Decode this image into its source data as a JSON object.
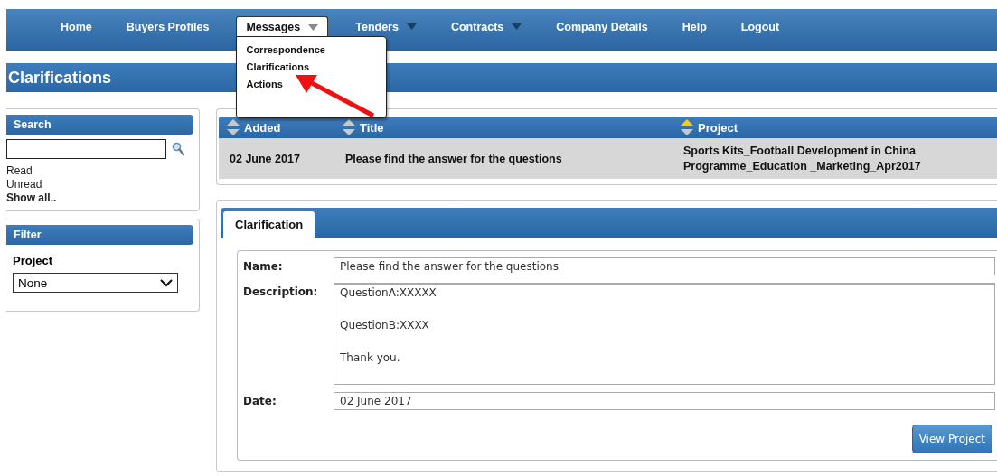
{
  "nav": {
    "items": [
      {
        "label": "Home",
        "selected": false,
        "has_menu": false
      },
      {
        "label": "Buyers Profiles",
        "selected": false,
        "has_menu": false
      },
      {
        "label": "Messages",
        "selected": true,
        "has_menu": true
      },
      {
        "label": "Tenders",
        "selected": false,
        "has_menu": true
      },
      {
        "label": "Contracts",
        "selected": false,
        "has_menu": true
      },
      {
        "label": "Company Details",
        "selected": false,
        "has_menu": false
      },
      {
        "label": "Help",
        "selected": false,
        "has_menu": false
      },
      {
        "label": "Logout",
        "selected": false,
        "has_menu": false
      }
    ],
    "open_menu": {
      "items": [
        "Correspondence",
        "Clarifications",
        "Actions"
      ]
    }
  },
  "page_title": "Clarifications",
  "search": {
    "title": "Search",
    "links": [
      {
        "label": "Read",
        "bold": false
      },
      {
        "label": "Unread",
        "bold": false
      },
      {
        "label": "Show all..",
        "bold": true
      }
    ]
  },
  "filter": {
    "title": "Filter",
    "field_label": "Project",
    "value": "None"
  },
  "table": {
    "columns": [
      {
        "label": "Added",
        "sorted": false
      },
      {
        "label": "Title",
        "sorted": false
      },
      {
        "label": "Project",
        "sorted": true
      }
    ],
    "rows": [
      {
        "cells": [
          "02 June 2017",
          "Please find the answer for the questions",
          "Sports Kits_Football Development in China Programme_Education _Marketing_Apr2017"
        ]
      }
    ]
  },
  "detail": {
    "tabs": [
      {
        "label": "Clarification",
        "selected": true
      }
    ],
    "fields": [
      {
        "kind": "line",
        "label": "Name:",
        "value": "Please find the answer for the questions"
      },
      {
        "kind": "area",
        "label": "Description:",
        "lines": [
          "QuestionA:XXXXX",
          "QuestionB:XXXX",
          "Thank you."
        ]
      },
      {
        "kind": "line",
        "label": "Date:",
        "value": "02 June 2017"
      }
    ],
    "button": "View Project"
  }
}
